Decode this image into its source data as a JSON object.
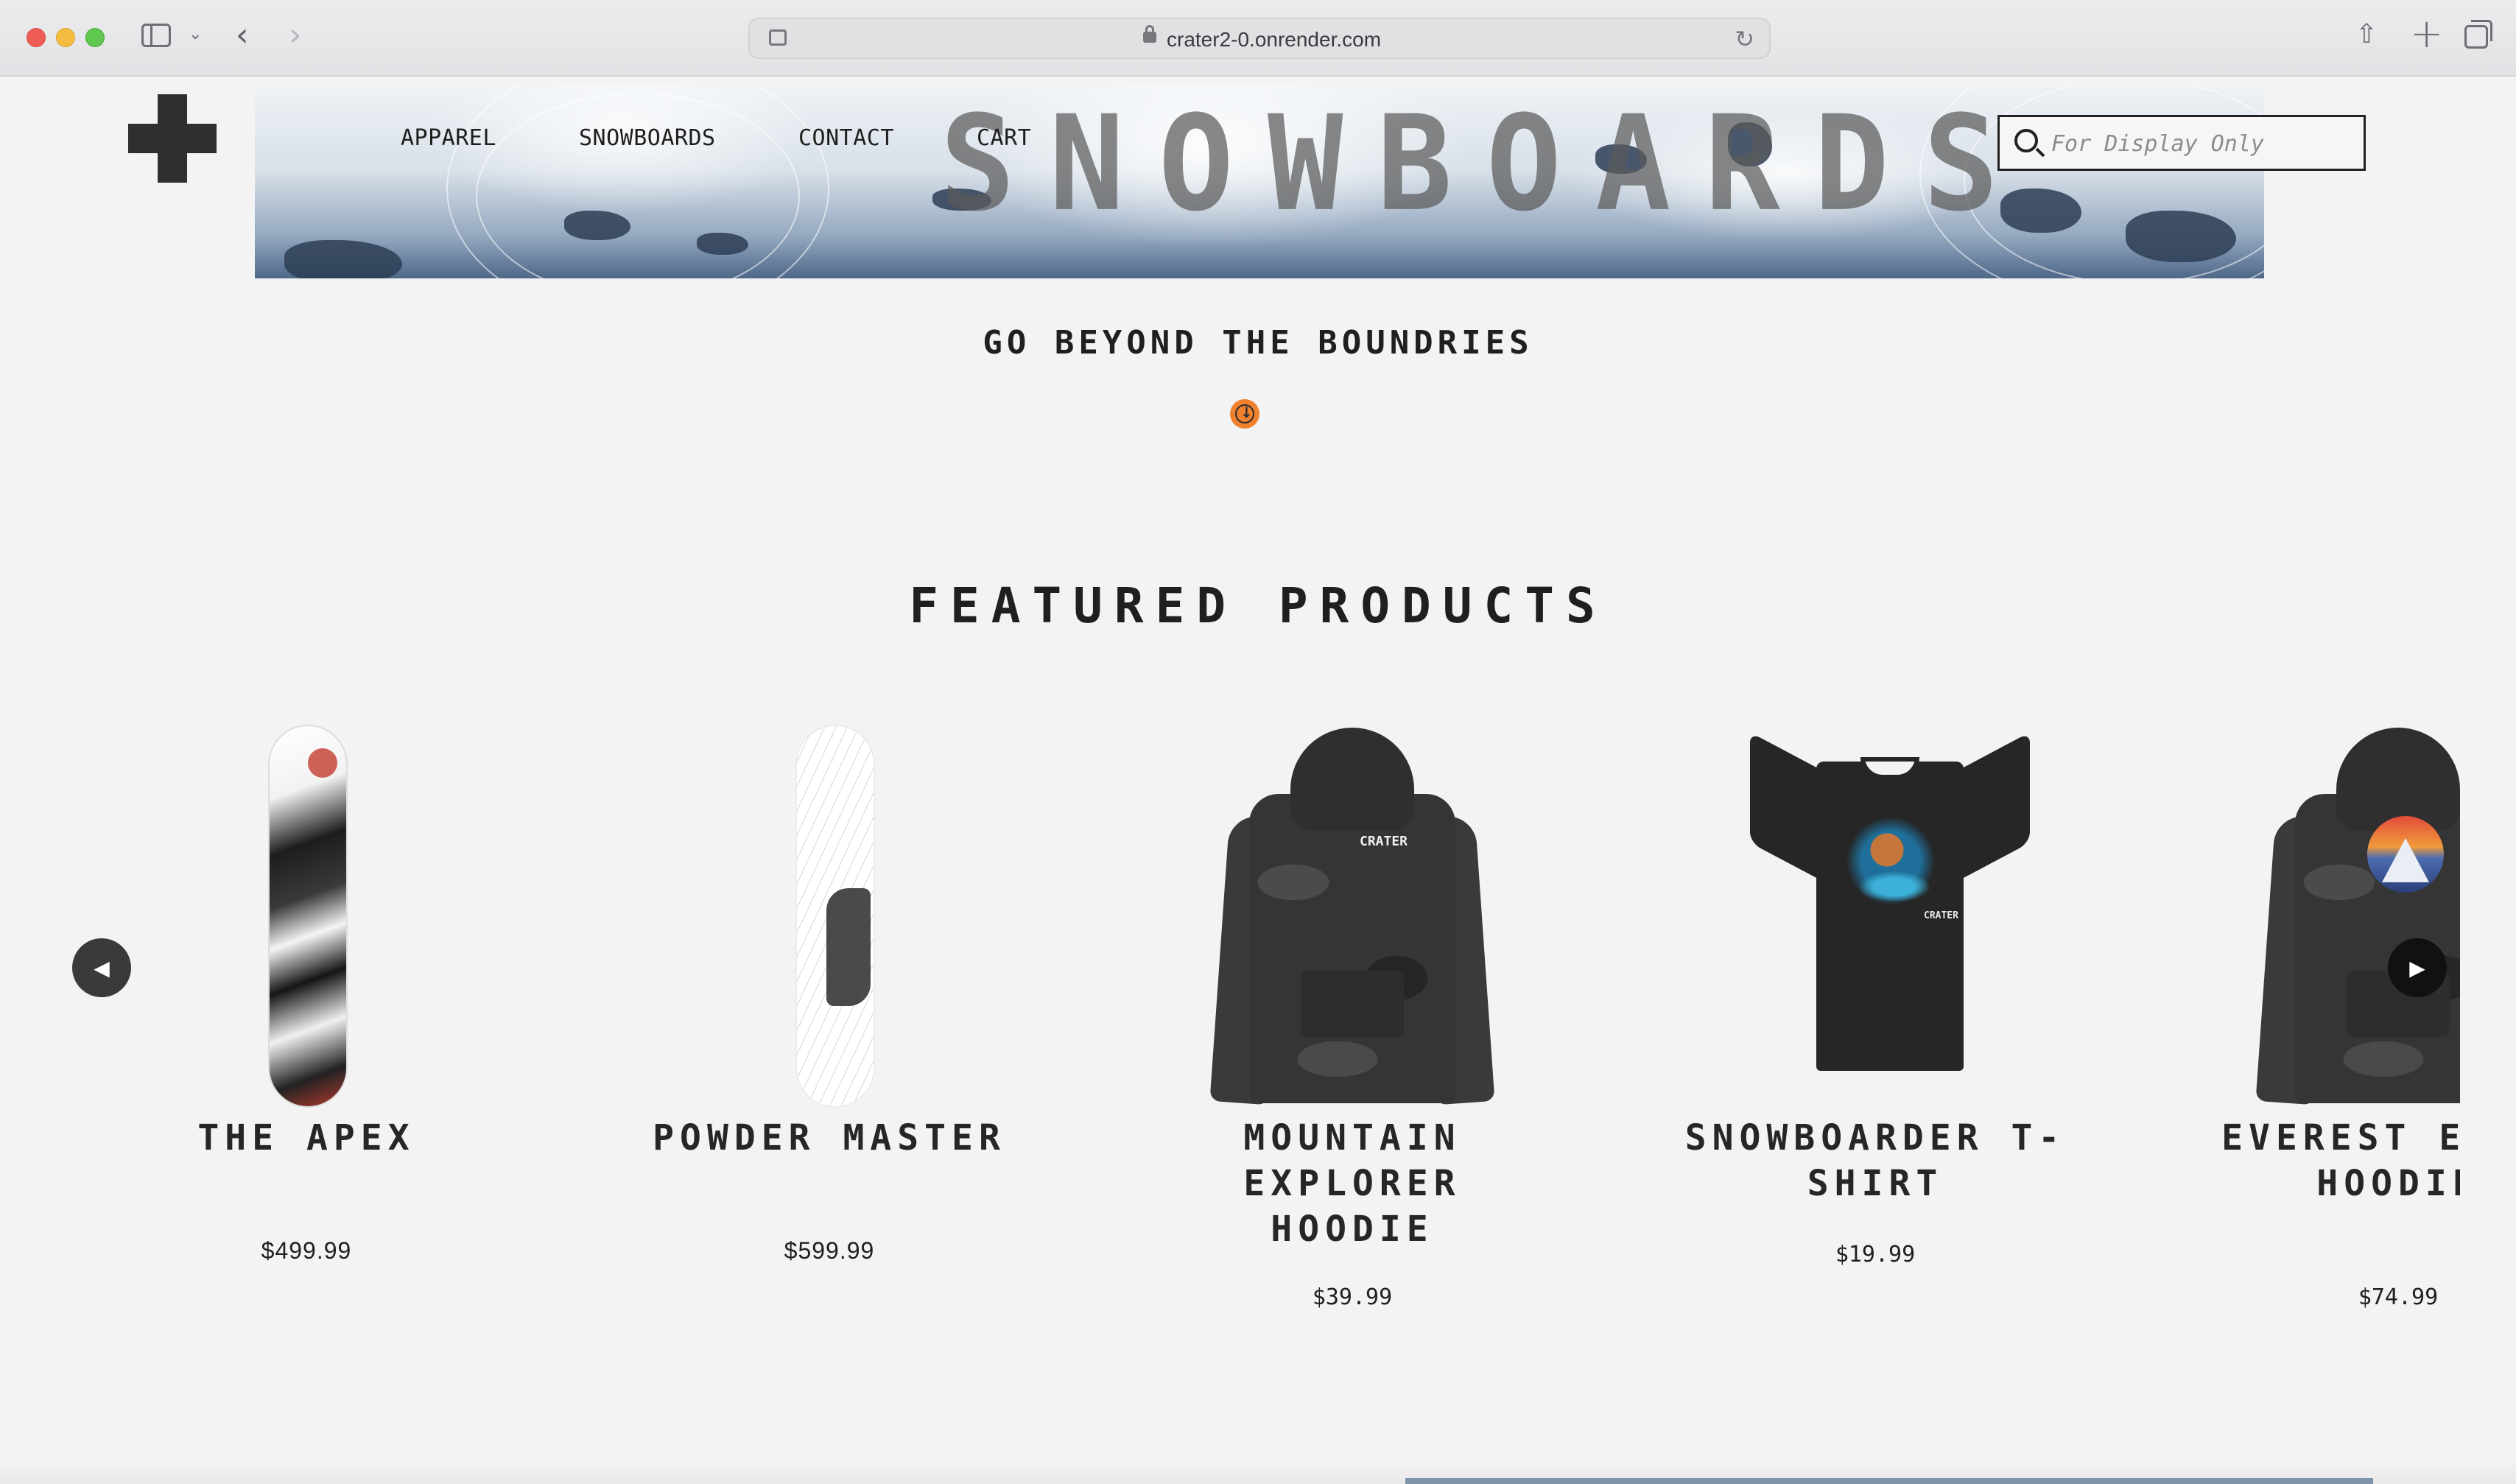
{
  "browser": {
    "url": "crater2-0.onrender.com"
  },
  "nav": {
    "items": [
      "APPAREL",
      "SNOWBOARDS",
      "CONTACT",
      "CART"
    ]
  },
  "hero": {
    "word": "SNOWBOARDS"
  },
  "search": {
    "placeholder": "For Display Only"
  },
  "tagline": "GO BEYOND THE BOUNDRIES",
  "featured": {
    "title": "FEATURED PRODUCTS",
    "products": [
      {
        "name": "THE APEX",
        "price": "$499.99",
        "image": "snowboard"
      },
      {
        "name": "POWDER MASTER",
        "price": "$599.99",
        "image": "snowboard"
      },
      {
        "name": "MOUNTAIN EXPLORER HOODIE",
        "price": "$39.99",
        "image": "hoodie"
      },
      {
        "name": "SNOWBOARDER T-SHIRT",
        "price": "$19.99",
        "image": "t-shirt"
      },
      {
        "name": "EVEREST EXPED HOODIE",
        "price": "$74.99",
        "image": "hoodie"
      }
    ]
  },
  "colors": {
    "accent": "#f0822f",
    "background": "#f3f3f3",
    "text": "#1f1f1f"
  },
  "icons": {
    "logo": "cross-logo-icon",
    "search": "search-icon",
    "scroll": "arrow-down-circle-icon",
    "prev": "carousel-prev-icon",
    "next": "carousel-next-icon"
  }
}
